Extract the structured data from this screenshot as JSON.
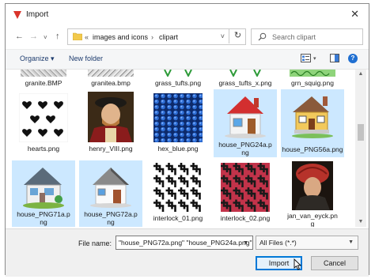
{
  "window": {
    "title": "Import",
    "close_glyph": "✕"
  },
  "nav": {
    "back_glyph": "←",
    "forward_glyph": "→",
    "recent_glyph": "˅",
    "up_glyph": "↑",
    "address_prefix": "«",
    "address_segments": [
      "images and icons",
      "›",
      "clipart"
    ],
    "address_dropdown_glyph": "˅",
    "refresh_glyph": "↻",
    "search_placeholder": "Search clipart"
  },
  "toolbar": {
    "organize_label": "Organize ▾",
    "new_folder_label": "New folder",
    "view_dropdown_glyph": "▾",
    "help_glyph": "?"
  },
  "files": {
    "top_row": [
      {
        "name": "granite.BMP",
        "selected": false
      },
      {
        "name": "granitea.bmp",
        "selected": false
      },
      {
        "name": "grass_tufts.png",
        "selected": false
      },
      {
        "name": "grass_tufts_x.png",
        "selected": false
      },
      {
        "name": "grn_squig.png",
        "selected": false
      }
    ],
    "row2": [
      {
        "name": "hearts.png",
        "selected": false
      },
      {
        "name": "henry_VIII.png",
        "selected": false
      },
      {
        "name": "hex_blue.png",
        "selected": false
      },
      {
        "name": "house_PNG24a.png",
        "line1": "house_PNG24a.p",
        "line2": "ng",
        "selected": true
      },
      {
        "name": "house_PNG56a.png",
        "line1": "house_PNG56a.png",
        "selected": true
      }
    ],
    "row3": [
      {
        "name": "house_PNG71a.png",
        "line1": "house_PNG71a.p",
        "line2": "ng",
        "selected": true
      },
      {
        "name": "house_PNG72a.png",
        "line1": "house_PNG72a.p",
        "line2": "ng",
        "selected": true
      },
      {
        "name": "interlock_01.png",
        "selected": false
      },
      {
        "name": "interlock_02.png",
        "selected": false
      },
      {
        "name": "jan_van_eyck.png",
        "line1": "jan_van_eyck.pn",
        "line2": "g",
        "selected": false
      }
    ]
  },
  "scrollbar": {
    "up_glyph": "▲",
    "down_glyph": "▼"
  },
  "footer": {
    "file_name_label": "File name:",
    "file_name_value": "\"house_PNG72a.png\" \"house_PNG24a.png\"",
    "file_name_dropdown_glyph": "▼",
    "filter_value": "All Files (*.*)",
    "filter_dropdown_glyph": "▼",
    "import_label": "Import",
    "cancel_label": "Cancel"
  },
  "colors": {
    "selection": "#cce8ff",
    "accent": "#0078d7",
    "title_icon": "#d9342b"
  }
}
